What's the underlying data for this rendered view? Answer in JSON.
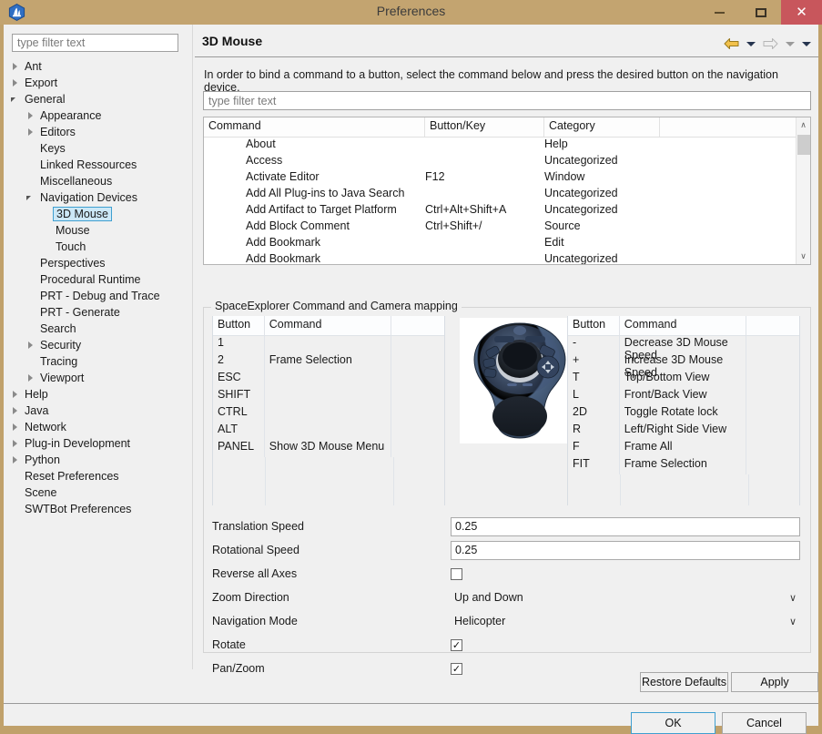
{
  "window": {
    "title": "Preferences",
    "icon": "app-logo-icon",
    "minimize_label": "–",
    "maximize_label": "☐",
    "close_label": "✕"
  },
  "sidebar": {
    "filter_placeholder": "type filter text",
    "items": [
      {
        "label": "Ant",
        "indent": 0,
        "arrow": "collapsed",
        "selected": false
      },
      {
        "label": "Export",
        "indent": 0,
        "arrow": "collapsed",
        "selected": false
      },
      {
        "label": "General",
        "indent": 0,
        "arrow": "expanded",
        "selected": false
      },
      {
        "label": "Appearance",
        "indent": 1,
        "arrow": "collapsed",
        "selected": false
      },
      {
        "label": "Editors",
        "indent": 1,
        "arrow": "collapsed",
        "selected": false
      },
      {
        "label": "Keys",
        "indent": 1,
        "arrow": "none",
        "selected": false
      },
      {
        "label": "Linked Ressources",
        "indent": 1,
        "arrow": "none",
        "selected": false
      },
      {
        "label": "Miscellaneous",
        "indent": 1,
        "arrow": "none",
        "selected": false
      },
      {
        "label": "Navigation Devices",
        "indent": 1,
        "arrow": "expanded",
        "selected": false
      },
      {
        "label": "3D Mouse",
        "indent": 2,
        "arrow": "none",
        "selected": true
      },
      {
        "label": "Mouse",
        "indent": 2,
        "arrow": "none",
        "selected": false
      },
      {
        "label": "Touch",
        "indent": 2,
        "arrow": "none",
        "selected": false
      },
      {
        "label": "Perspectives",
        "indent": 1,
        "arrow": "none",
        "selected": false
      },
      {
        "label": "Procedural Runtime",
        "indent": 1,
        "arrow": "none",
        "selected": false
      },
      {
        "label": "PRT - Debug and Trace",
        "indent": 1,
        "arrow": "none",
        "selected": false
      },
      {
        "label": "PRT - Generate",
        "indent": 1,
        "arrow": "none",
        "selected": false
      },
      {
        "label": "Search",
        "indent": 1,
        "arrow": "none",
        "selected": false
      },
      {
        "label": "Security",
        "indent": 1,
        "arrow": "collapsed",
        "selected": false
      },
      {
        "label": "Tracing",
        "indent": 1,
        "arrow": "none",
        "selected": false
      },
      {
        "label": "Viewport",
        "indent": 1,
        "arrow": "collapsed",
        "selected": false
      },
      {
        "label": "Help",
        "indent": 0,
        "arrow": "collapsed",
        "selected": false
      },
      {
        "label": "Java",
        "indent": 0,
        "arrow": "collapsed",
        "selected": false
      },
      {
        "label": "Network",
        "indent": 0,
        "arrow": "collapsed",
        "selected": false
      },
      {
        "label": "Plug-in Development",
        "indent": 0,
        "arrow": "collapsed",
        "selected": false
      },
      {
        "label": "Python",
        "indent": 0,
        "arrow": "collapsed",
        "selected": false
      },
      {
        "label": "Reset Preferences",
        "indent": 0,
        "arrow": "none",
        "selected": false
      },
      {
        "label": "Scene",
        "indent": 0,
        "arrow": "none",
        "selected": false
      },
      {
        "label": "SWTBot Preferences",
        "indent": 0,
        "arrow": "none",
        "selected": false
      }
    ]
  },
  "content": {
    "page_title": "3D Mouse",
    "description": "In order to bind a command to a button, select the command below and press the desired button on the navigation device.",
    "command_filter_placeholder": "type filter text",
    "nav": {
      "back_icon": "back-arrow-icon",
      "back_caret": "▼",
      "forward_icon": "forward-arrow-icon",
      "forward_caret": "▼",
      "menu_caret": "▼"
    },
    "command_table": {
      "headers": [
        "Command",
        "Button/Key",
        "Category",
        ""
      ],
      "sort_column": "Command",
      "rows": [
        {
          "command": "About",
          "key": "",
          "category": "Help"
        },
        {
          "command": "Access",
          "key": "",
          "category": "Uncategorized"
        },
        {
          "command": "Activate Editor",
          "key": "F12",
          "category": "Window"
        },
        {
          "command": "Add All Plug-ins to Java Search",
          "key": "",
          "category": "Uncategorized"
        },
        {
          "command": "Add Artifact to Target Platform",
          "key": "Ctrl+Alt+Shift+A",
          "category": "Uncategorized"
        },
        {
          "command": "Add Block Comment",
          "key": "Ctrl+Shift+/",
          "category": "Source"
        },
        {
          "command": "Add Bookmark",
          "key": "",
          "category": "Edit"
        },
        {
          "command": "Add Bookmark",
          "key": "",
          "category": "Uncategorized"
        }
      ],
      "scrollbar": {
        "up_icon": "∧",
        "down_icon": "∨"
      }
    },
    "group": {
      "title": "SpaceExplorer Command and Camera mapping",
      "device_image_alt": "spaceexplorer-3d-mouse-device",
      "left_table": {
        "headers": [
          "Button",
          "Command",
          ""
        ],
        "rows": [
          {
            "button": "1",
            "command": ""
          },
          {
            "button": "2",
            "command": "Frame Selection"
          },
          {
            "button": "ESC",
            "command": ""
          },
          {
            "button": "SHIFT",
            "command": ""
          },
          {
            "button": "CTRL",
            "command": ""
          },
          {
            "button": "ALT",
            "command": ""
          },
          {
            "button": "PANEL",
            "command": "Show 3D Mouse Menu"
          }
        ]
      },
      "right_table": {
        "headers": [
          "Button",
          "Command",
          ""
        ],
        "rows": [
          {
            "button": "-",
            "command": "Decrease 3D Mouse Speed"
          },
          {
            "button": "+",
            "command": "Increase 3D Mouse Speed"
          },
          {
            "button": "T",
            "command": "Top/Bottom View"
          },
          {
            "button": "L",
            "command": "Front/Back View"
          },
          {
            "button": "2D",
            "command": "Toggle Rotate lock"
          },
          {
            "button": "R",
            "command": "Left/Right Side View"
          },
          {
            "button": "F",
            "command": "Frame All"
          },
          {
            "button": "FIT",
            "command": "Frame Selection"
          }
        ]
      },
      "settings": [
        {
          "label": "Translation Speed",
          "type": "text",
          "value": "0.25"
        },
        {
          "label": "Rotational Speed",
          "type": "text",
          "value": "0.25"
        },
        {
          "label": "Reverse all Axes",
          "type": "checkbox",
          "checked": false,
          "value": ""
        },
        {
          "label": "Zoom Direction",
          "type": "combo",
          "value": "Up and Down"
        },
        {
          "label": "Navigation Mode",
          "type": "combo",
          "value": "Helicopter"
        },
        {
          "label": "Rotate",
          "type": "checkbox",
          "checked": true,
          "value": "✓"
        },
        {
          "label": "Pan/Zoom",
          "type": "checkbox",
          "checked": true,
          "value": "✓"
        }
      ]
    }
  },
  "buttons": {
    "restore_defaults": "Restore Defaults",
    "apply": "Apply",
    "ok": "OK",
    "cancel": "Cancel"
  },
  "colors": {
    "titlebar": "#c3a470",
    "close": "#c8565c",
    "selection": "#cce8f7",
    "selection_border": "#3f9fd0",
    "panel": "#f0f0f0"
  }
}
